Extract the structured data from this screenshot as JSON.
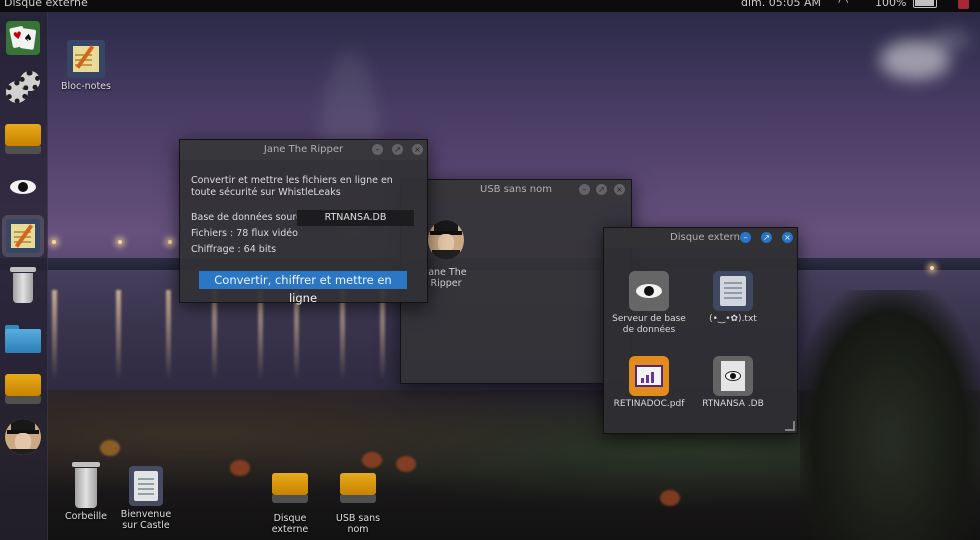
{
  "top_panel": {
    "title": "Disque externe",
    "clock": "dim. 05:05 AM",
    "battery_percent": "100%",
    "icons": [
      "wifi-icon",
      "battery-icon",
      "power-icon"
    ]
  },
  "launcher": {
    "items": [
      {
        "name": "solitaire",
        "icon": "cards-icon"
      },
      {
        "name": "settings",
        "icon": "gear-icon"
      },
      {
        "name": "drive",
        "icon": "drive-icon"
      },
      {
        "name": "eye-app",
        "icon": "eye-icon"
      },
      {
        "name": "bloc-notes",
        "icon": "notepad-icon"
      },
      {
        "name": "trash",
        "icon": "trash-icon"
      },
      {
        "name": "folder",
        "icon": "folder-icon"
      },
      {
        "name": "drive-2",
        "icon": "drive-icon"
      },
      {
        "name": "jane-avatar",
        "icon": "avatar-icon"
      }
    ]
  },
  "desktop": {
    "icons": [
      {
        "label": "Bloc-notes",
        "icon": "notepad-icon"
      },
      {
        "label": "Corbeille",
        "icon": "trash-icon"
      },
      {
        "label": "Bienvenue sur Castle",
        "icon": "document-icon"
      },
      {
        "label": "Disque externe",
        "icon": "drive-icon"
      },
      {
        "label": "USB sans nom",
        "icon": "drive-icon"
      }
    ]
  },
  "window_jane": {
    "title": "Jane The Ripper",
    "description": "Convertir et mettre les fichiers en ligne en toute sécurité sur WhistleLeaks",
    "source_label": "Base de données source :",
    "source_value": "RTNANSA.DB",
    "files_line": "Fichiers : 78 flux vidéo",
    "encryption_line": "Chiffrage : 64 bits",
    "action_button": "Convertir, chiffrer et mettre en ligne"
  },
  "window_usb": {
    "title": "USB sans nom",
    "items": [
      {
        "label": "Jane The Ripper",
        "icon": "avatar-icon"
      }
    ]
  },
  "window_disque": {
    "title": "Disque externe",
    "items": [
      {
        "label": "Serveur de base de données",
        "icon": "eye-icon"
      },
      {
        "label": "(•‿•✿).txt",
        "icon": "text-file-icon"
      },
      {
        "label": "RETINADOC.pdf",
        "icon": "chart-file-icon"
      },
      {
        "label": "RTNANSA .DB",
        "icon": "database-file-icon"
      }
    ]
  },
  "colors": {
    "accent": "#2d7ed0",
    "panel": "#0d0d10",
    "window": "#36363a",
    "drive": "#f3b41c"
  }
}
